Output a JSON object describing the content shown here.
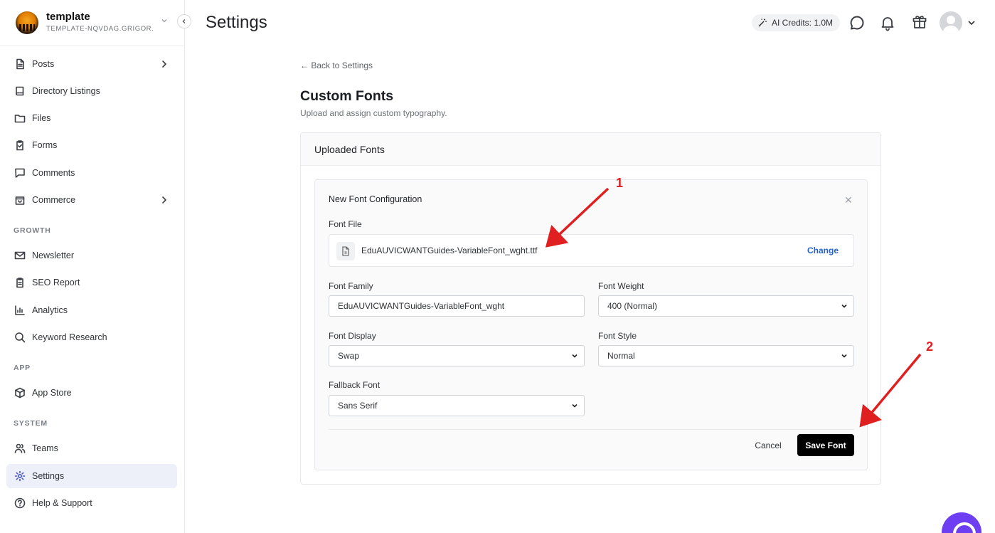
{
  "workspace": {
    "name": "template",
    "id": "TEMPLATE-NQVDAG.GRIGOR..."
  },
  "sidebar": {
    "items": [
      {
        "label": "Posts",
        "icon": "document-icon"
      },
      {
        "label": "Directory Listings",
        "icon": "book-icon"
      },
      {
        "label": "Files",
        "icon": "folder-icon"
      },
      {
        "label": "Forms",
        "icon": "clipboard-icon"
      },
      {
        "label": "Comments",
        "icon": "comment-icon"
      },
      {
        "label": "Commerce",
        "icon": "bag-icon"
      }
    ],
    "sections": {
      "growth": "GROWTH",
      "app": "APP",
      "system": "SYSTEM"
    },
    "growth_items": [
      {
        "label": "Newsletter",
        "icon": "mail-icon"
      },
      {
        "label": "SEO Report",
        "icon": "clipboard-icon"
      },
      {
        "label": "Analytics",
        "icon": "chart-icon"
      },
      {
        "label": "Keyword Research",
        "icon": "search-icon"
      }
    ],
    "app_items": [
      {
        "label": "App Store",
        "icon": "box-icon"
      }
    ],
    "system_items": [
      {
        "label": "Teams",
        "icon": "users-icon"
      },
      {
        "label": "Settings",
        "icon": "gear-icon"
      },
      {
        "label": "Help & Support",
        "icon": "help-icon"
      }
    ]
  },
  "header": {
    "title": "Settings",
    "credits": "AI Credits: 1.0M"
  },
  "page": {
    "back": "← Back to Settings",
    "title": "Custom Fonts",
    "subtitle": "Upload and assign custom typography.",
    "card_title": "Uploaded Fonts"
  },
  "form": {
    "title": "New Font Configuration",
    "font_file_label": "Font File",
    "file_name": "EduAUVICWANTGuides-VariableFont_wght.ttf",
    "change": "Change",
    "family_label": "Font Family",
    "family_value": "EduAUVICWANTGuides-VariableFont_wght",
    "weight_label": "Font Weight",
    "weight_value": "400 (Normal)",
    "display_label": "Font Display",
    "display_value": "Swap",
    "style_label": "Font Style",
    "style_value": "Normal",
    "fallback_label": "Fallback Font",
    "fallback_value": "Sans Serif",
    "cancel": "Cancel",
    "save": "Save Font"
  },
  "annotations": {
    "one": "1",
    "two": "2"
  },
  "colors": {
    "accent_link": "#2563c9",
    "annotation": "#e02020",
    "active_nav": "#eef0f9",
    "save_button": "#000000"
  }
}
